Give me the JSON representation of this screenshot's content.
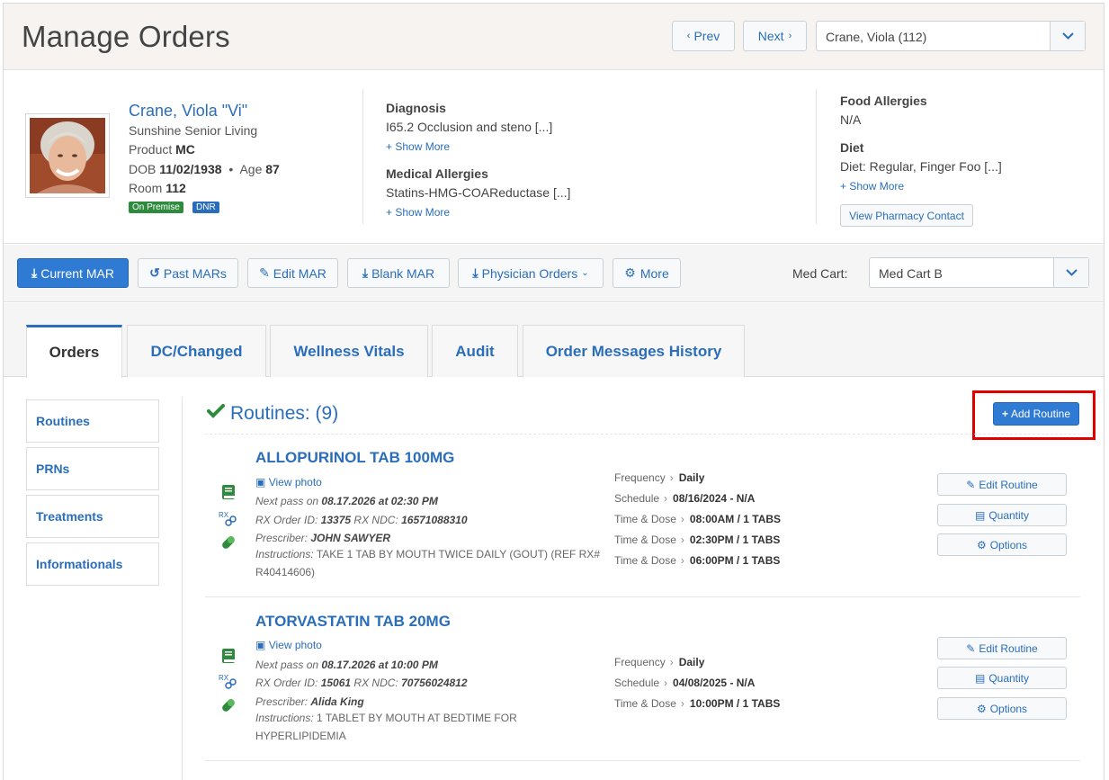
{
  "header": {
    "title": "Manage Orders",
    "prev_label": "Prev",
    "next_label": "Next",
    "resident_select": "Crane, Viola (112)"
  },
  "patient": {
    "name": "Crane, Viola \"Vi\"",
    "facility": "Sunshine Senior Living",
    "product_label": "Product",
    "product": "MC",
    "dob_label": "DOB",
    "dob": "11/02/1938",
    "age_label": "Age",
    "age": "87",
    "room_label": "Room",
    "room": "112",
    "badges": [
      "On Premise",
      "DNR"
    ],
    "diagnosis_label": "Diagnosis",
    "diagnosis": "I65.2 Occlusion and steno [...]",
    "medical_allergies_label": "Medical Allergies",
    "medical_allergies": "Statins-HMG-COAReductase [...]",
    "food_allergies_label": "Food Allergies",
    "food_allergies": "N/A",
    "diet_label": "Diet",
    "diet": "Diet: Regular, Finger Foo [...]",
    "show_more": "Show More",
    "pharmacy_button": "View Pharmacy Contact"
  },
  "toolbar": {
    "current_mar": "Current MAR",
    "past_mars": "Past MARs",
    "edit_mar": "Edit MAR",
    "blank_mar": "Blank MAR",
    "physician_orders": "Physician Orders",
    "more": "More",
    "med_cart_label": "Med Cart:",
    "med_cart_value": "Med Cart B"
  },
  "tabs": [
    "Orders",
    "DC/Changed",
    "Wellness Vitals",
    "Audit",
    "Order Messages History"
  ],
  "sidenav": [
    "Routines",
    "PRNs",
    "Treatments",
    "Informationals"
  ],
  "routines": {
    "title": "Routines: (9)",
    "add_button": "Add Routine",
    "view_photo": "View photo",
    "next_pass_label": "Next pass on",
    "rx_order_label": "RX Order ID:",
    "rx_ndc_label": "RX NDC:",
    "prescriber_label": "Prescriber:",
    "instructions_label": "Instructions:",
    "frequency_label": "Frequency",
    "schedule_label": "Schedule",
    "time_dose_label": "Time & Dose",
    "edit_label": "Edit Routine",
    "quantity_label": "Quantity",
    "options_label": "Options",
    "items": [
      {
        "name": "ALLOPURINOL TAB 100MG",
        "next_pass": "08.17.2026 at 02:30 PM",
        "rx_order_id": "13375",
        "rx_ndc": "16571088310",
        "prescriber": "JOHN SAWYER",
        "instructions": "TAKE 1 TAB BY MOUTH TWICE DAILY (GOUT) (REF RX# R40414606)",
        "frequency": "Daily",
        "schedule": "08/16/2024 - N/A",
        "times": [
          "08:00AM / 1 TABS",
          "02:30PM / 1 TABS",
          "06:00PM / 1 TABS"
        ]
      },
      {
        "name": "ATORVASTATIN TAB 20MG",
        "next_pass": "08.17.2026 at 10:00 PM",
        "rx_order_id": "15061",
        "rx_ndc": "70756024812",
        "prescriber": "Alida King",
        "instructions": "1 TABLET BY MOUTH AT BEDTIME FOR HYPERLIPIDEMIA",
        "frequency": "Daily",
        "schedule": "04/08/2025 - N/A",
        "times": [
          "10:00PM / 1 TABS"
        ]
      }
    ]
  },
  "colors": {
    "link_blue": "#2a6ebb",
    "primary_button": "#2f7bd4",
    "badge_green": "#2e8b3e",
    "icon_green": "#2e8b3e",
    "highlight_red": "#e00000"
  }
}
